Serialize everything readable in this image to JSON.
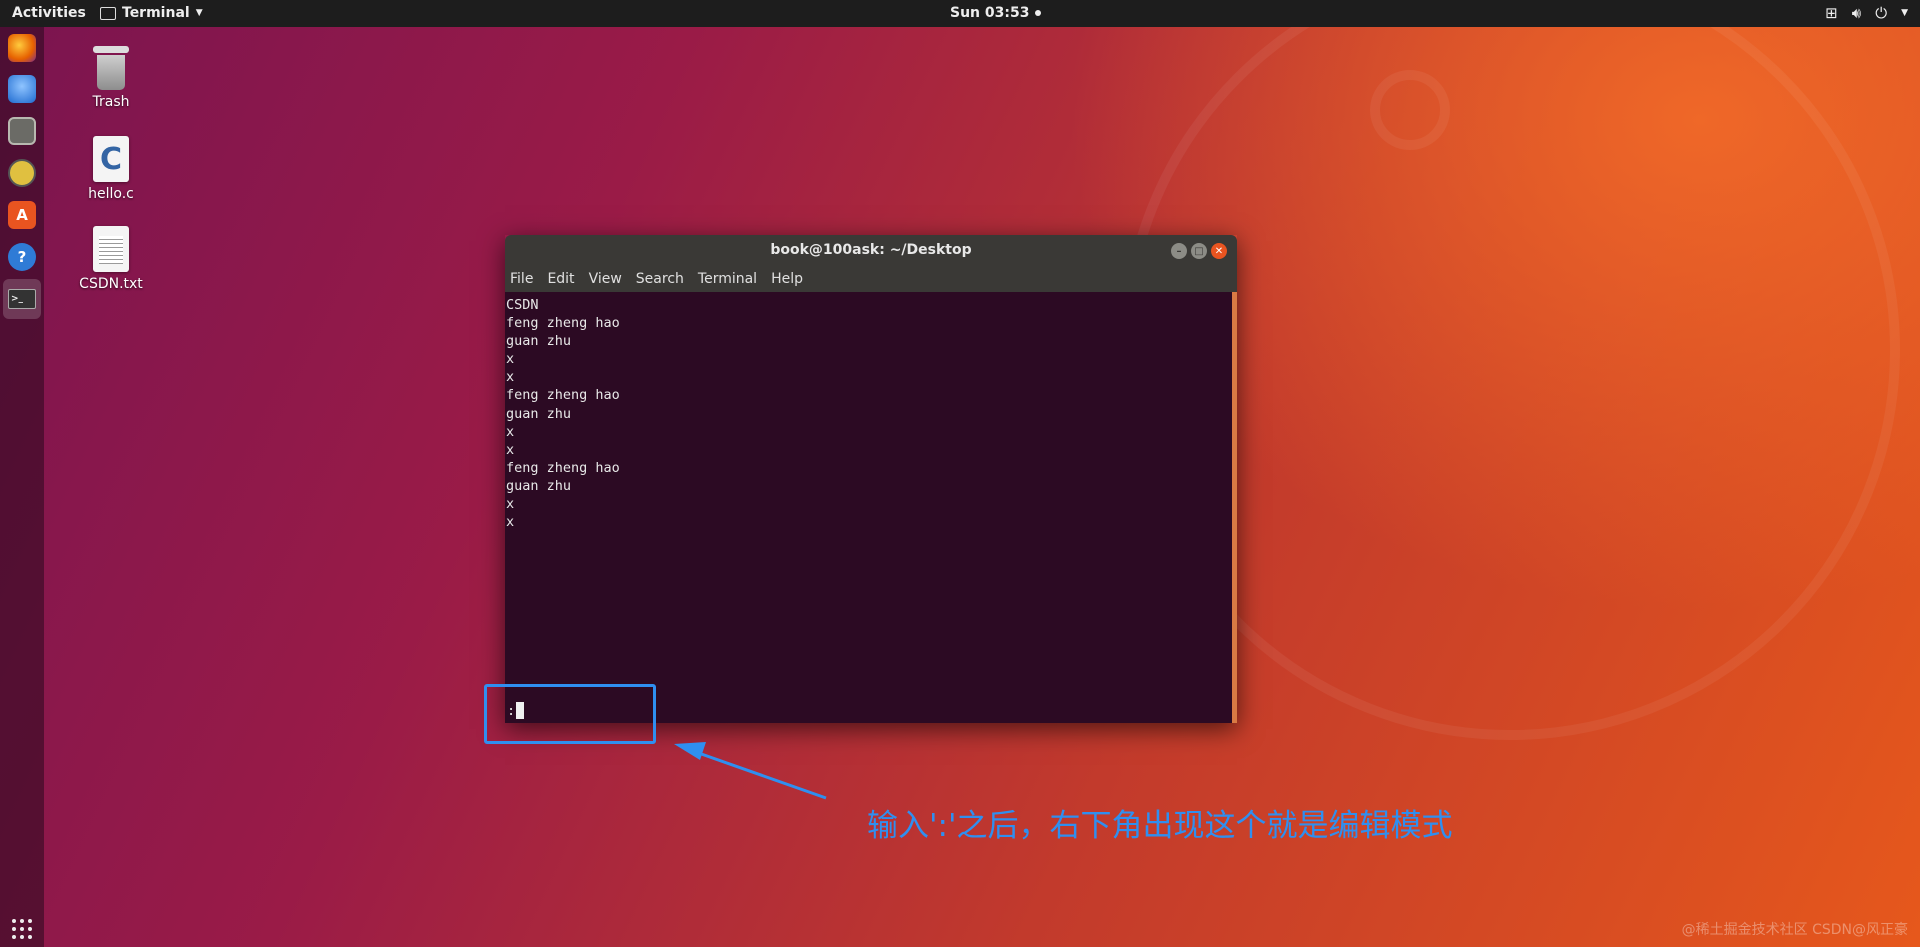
{
  "topbar": {
    "activities": "Activities",
    "app_name": "Terminal",
    "clock": "Sun 03:53",
    "tray_icons": [
      "network-icon",
      "volume-icon",
      "power-icon",
      "chevron-down-icon"
    ]
  },
  "dock": {
    "items": [
      "firefox-icon",
      "thunderbird-icon",
      "files-icon",
      "rhythmbox-icon",
      "software-center-icon",
      "help-icon",
      "terminal-icon"
    ],
    "help_glyph": "?"
  },
  "desktop": {
    "icons": [
      {
        "label": "Trash",
        "icon": "trash-icon"
      },
      {
        "label": "hello.c",
        "icon": "c-source-file-icon"
      },
      {
        "label": "CSDN.txt",
        "icon": "text-file-icon"
      }
    ]
  },
  "terminal": {
    "title": "book@100ask: ~/Desktop",
    "menu": [
      "File",
      "Edit",
      "View",
      "Search",
      "Terminal",
      "Help"
    ],
    "lines": [
      "CSDN",
      "feng zheng hao",
      "guan zhu",
      "x",
      "x",
      "feng zheng hao",
      "guan zhu",
      "x",
      "x",
      "feng zheng hao",
      "guan zhu",
      "x",
      "x"
    ],
    "command_prompt": ":"
  },
  "annotation": {
    "text": "输入':'之后，右下角出现这个就是编辑模式",
    "color": "#2f8ff0"
  },
  "watermark": "@稀土掘金技术社区 CSDN@风正豪"
}
